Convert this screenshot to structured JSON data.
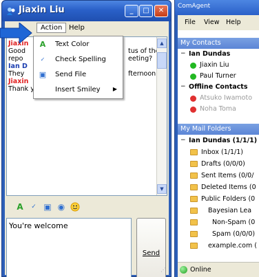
{
  "chat_window": {
    "title": "Jiaxin Liu",
    "buttons": {
      "minimize": "_",
      "maximize": "□",
      "close": "✕"
    },
    "menu": {
      "action": "Action",
      "help": "Help"
    },
    "transcript": {
      "lines": [
        {
          "name": "Jiaxin",
          "text": ""
        },
        {
          "name": "",
          "text": "Good"
        },
        {
          "name": "",
          "text": "repo"
        },
        {
          "name": "Ian D",
          "text": ""
        },
        {
          "name": "",
          "text": "They"
        },
        {
          "name": "Jiaxin",
          "text": ""
        },
        {
          "name": "",
          "text": "Thank you."
        }
      ],
      "right_fragments": [
        "tus of the",
        "eeting?",
        "fternoon."
      ]
    },
    "dropdown": {
      "items": [
        {
          "icon": "text-color-icon",
          "label": "Text Color"
        },
        {
          "icon": "check-spelling-icon",
          "label": "Check Spelling"
        },
        {
          "icon": "send-file-icon",
          "label": "Send File"
        },
        {
          "icon": "insert-smiley-icon",
          "label": "Insert Smiley",
          "submenu": "▶"
        }
      ]
    },
    "toolbar_icons": [
      "text-color-icon",
      "check-spelling-icon",
      "send-file-icon",
      "globe-icon",
      "smiley-icon"
    ],
    "input_text": "You're welcome",
    "send_label": "Send"
  },
  "agent_window": {
    "title": "ComAgent",
    "menu": {
      "file": "File",
      "view": "View",
      "help": "Help"
    },
    "contacts_header": "My Contacts",
    "contacts": {
      "owner": "Ian Dundas",
      "online": [
        "Jiaxin Liu",
        "Paul Turner"
      ],
      "offline_header": "Offline Contacts",
      "offline": [
        "Atsuko Iwamoto",
        "Noha Toma"
      ]
    },
    "mail_header": "My Mail Folders",
    "mail": {
      "root": "Ian Dundas (1/1/1)",
      "folders": [
        "Inbox (1/1/1)",
        "Drafts (0/0/0)",
        "Sent Items (0/0/",
        "Deleted Items (0",
        "Public Folders (0",
        "Bayesian Lea",
        "Non-Spam (0",
        "Spam (0/0/0)",
        "example.com ("
      ]
    },
    "status": "Online"
  },
  "colors": {
    "title_bar": "#2a60c8",
    "name_red": "#e02020",
    "name_blue": "#1c3fb0",
    "online_green": "#22b822",
    "offline_red": "#e03030",
    "pointer_arrow": "#1f66d6"
  }
}
